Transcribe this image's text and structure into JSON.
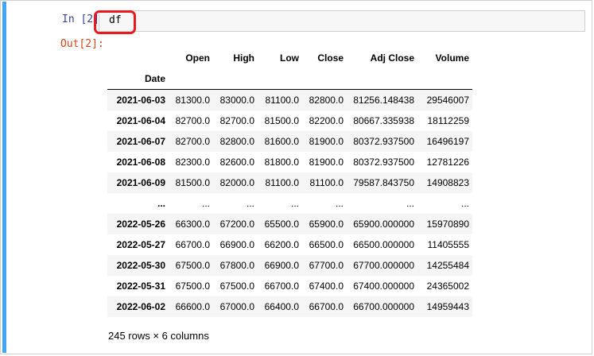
{
  "prompts": {
    "in": "In [2]:",
    "out": "Out[2]:"
  },
  "input": {
    "code": "df"
  },
  "colors": {
    "cell_bar": "#42a5f5",
    "highlight_ring": "#e8191f",
    "in_prompt": "#303f9f",
    "out_prompt": "#d84315"
  },
  "dataframe": {
    "columns": [
      "Open",
      "High",
      "Low",
      "Close",
      "Adj Close",
      "Volume"
    ],
    "index_name": "Date",
    "rows": [
      {
        "index": "2021-06-03",
        "cells": [
          "81300.0",
          "83000.0",
          "81100.0",
          "82800.0",
          "81256.148438",
          "29546007"
        ]
      },
      {
        "index": "2021-06-04",
        "cells": [
          "82700.0",
          "82700.0",
          "81500.0",
          "82200.0",
          "80667.335938",
          "18112259"
        ]
      },
      {
        "index": "2021-06-07",
        "cells": [
          "82700.0",
          "82800.0",
          "81600.0",
          "81900.0",
          "80372.937500",
          "16496197"
        ]
      },
      {
        "index": "2021-06-08",
        "cells": [
          "82300.0",
          "82600.0",
          "81800.0",
          "81900.0",
          "80372.937500",
          "12781226"
        ]
      },
      {
        "index": "2021-06-09",
        "cells": [
          "81500.0",
          "82000.0",
          "81100.0",
          "81100.0",
          "79587.843750",
          "14908823"
        ]
      },
      {
        "index": "...",
        "cells": [
          "...",
          "...",
          "...",
          "...",
          "...",
          "..."
        ]
      },
      {
        "index": "2022-05-26",
        "cells": [
          "66300.0",
          "67200.0",
          "65500.0",
          "65900.0",
          "65900.000000",
          "15970890"
        ]
      },
      {
        "index": "2022-05-27",
        "cells": [
          "66700.0",
          "66900.0",
          "66200.0",
          "66500.0",
          "66500.000000",
          "11405555"
        ]
      },
      {
        "index": "2022-05-30",
        "cells": [
          "67500.0",
          "67800.0",
          "66900.0",
          "67700.0",
          "67700.000000",
          "14255484"
        ]
      },
      {
        "index": "2022-05-31",
        "cells": [
          "67500.0",
          "67500.0",
          "66700.0",
          "67400.0",
          "67400.000000",
          "24365002"
        ]
      },
      {
        "index": "2022-06-02",
        "cells": [
          "66600.0",
          "67000.0",
          "66400.0",
          "66700.0",
          "66700.000000",
          "14959443"
        ]
      }
    ],
    "summary": "245 rows × 6 columns"
  }
}
